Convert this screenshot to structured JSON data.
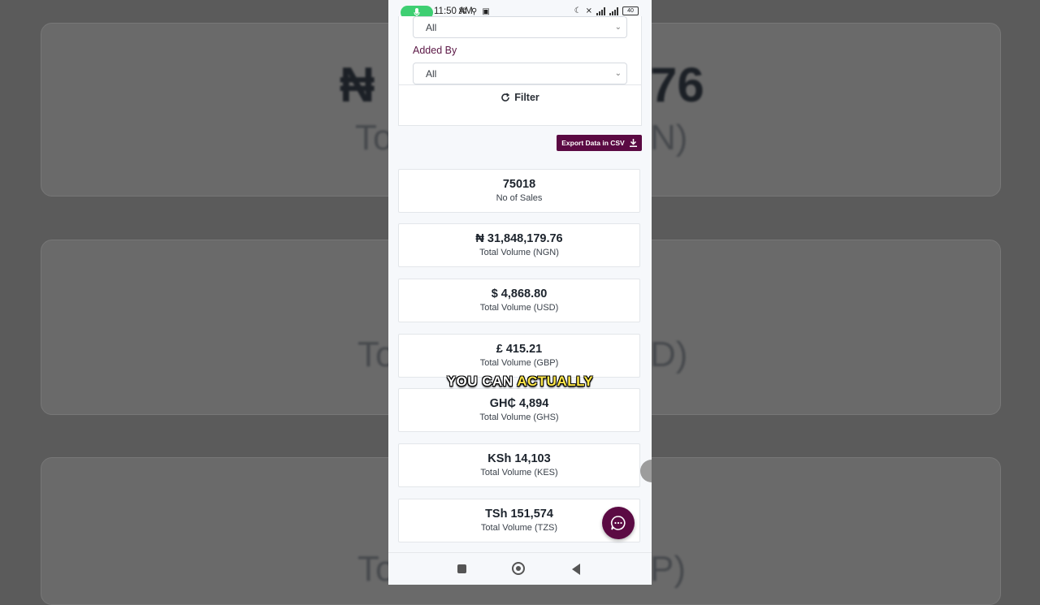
{
  "background": {
    "cards": [
      {
        "big_value": "₦",
        "big_value_right": "76",
        "label": "To",
        "label_right": "N)"
      },
      {
        "label": "To",
        "label_right": "D)"
      },
      {
        "label": "To",
        "label_right": "P)"
      }
    ]
  },
  "statusbar": {
    "time": "11:50 AM",
    "battery": "40",
    "network": "4G"
  },
  "filters": {
    "first_select_value": "All",
    "added_by_label": "Added By",
    "added_by_value": "All",
    "filter_button_label": "Filter"
  },
  "export": {
    "label": "Export Data in CSV"
  },
  "stats": [
    {
      "value": "75018",
      "label": "No of Sales"
    },
    {
      "value": "₦ 31,848,179.76",
      "label": "Total Volume (NGN)"
    },
    {
      "value": "$ 4,868.80",
      "label": "Total Volume (USD)"
    },
    {
      "value": "£ 415.21",
      "label": "Total Volume (GBP)"
    },
    {
      "value": "GH₵ 4,894",
      "label": "Total Volume (GHS)"
    },
    {
      "value": "KSh 14,103",
      "label": "Total Volume (KES)"
    },
    {
      "value": "TSh 151,574",
      "label": "Total Volume (TZS)"
    }
  ],
  "caption": {
    "plain": "YOU CAN",
    "highlight": "ACTUALLY"
  },
  "colors": {
    "brand": "#5b0a43",
    "caption_highlight": "#ffe94a",
    "mic_pill": "#3ecf72"
  }
}
